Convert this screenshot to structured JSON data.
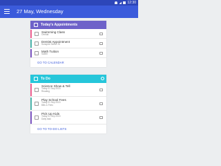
{
  "status_bar": {
    "time": "12:30",
    "color": "#2d46b9"
  },
  "app_bar": {
    "title": "27 May, Wednesday",
    "color": "#3b5bdb",
    "menu_icon": "hamburger-icon"
  },
  "appointments": {
    "header_label": "Today's Appointments",
    "header_color": "#6e62c9",
    "items": [
      {
        "title": "Swimming Class",
        "subtitle": "Oneida",
        "accent": "#f06292"
      },
      {
        "title": "Dentist Appointment",
        "subtitle": "Sunspire Senter St",
        "accent": "#4db6ac"
      },
      {
        "title": "Math Tuition",
        "subtitle": "Salem",
        "accent": "#7e57c2"
      }
    ],
    "link_label": "GO TO CALENDAR"
  },
  "todo": {
    "header_label": "To Do",
    "header_color": "#26c6da",
    "items": [
      {
        "title": "Science Show & Tell",
        "subtitle": "Today 01 Sep 2015",
        "note": "Reading",
        "accent": "#f06292"
      },
      {
        "title": "Play School Fees",
        "subtitle": "Today 01 Sep 2015",
        "note": "Bills & Fees",
        "accent": "#4db6ac"
      },
      {
        "title": "Pick Up Kids",
        "subtitle": "Today 01 Sep 2015",
        "note": "Daily task",
        "accent": "#7e57c2"
      }
    ],
    "link_label": "GO TO TO-DO LISTS"
  }
}
